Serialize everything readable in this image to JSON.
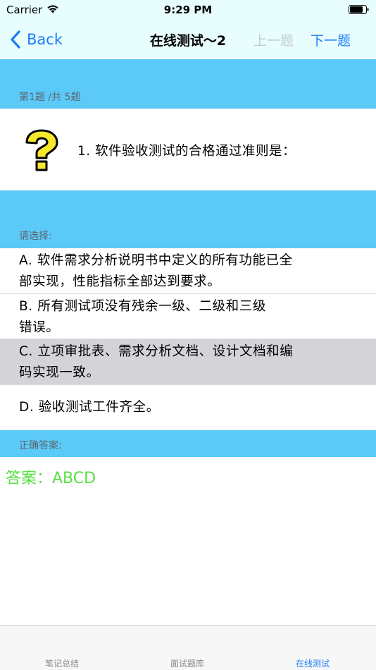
{
  "status_bar": {
    "carrier": "Carrier",
    "time": "9:29 PM"
  },
  "nav": {
    "back_label": "Back",
    "title": "在线测试～2",
    "prev_label": "上一题",
    "next_label": "下一题"
  },
  "question": {
    "progress": "第1题 /共 5题",
    "text": "1.  软件验收测试的合格通过准则是："
  },
  "options_section": {
    "label": "请选择:",
    "options": [
      {
        "line1": "A.   软件需求分析说明书中定义的所有功能已全",
        "line2": "部实现，性能指标全部达到要求。"
      },
      {
        "line1": "B.   所有测试项没有残余一级、二级和三级",
        "line2": "错误。"
      },
      {
        "line1": "C.   立项审批表、需求分析文档、设计文档和编",
        "line2": "码实现一致。"
      },
      {
        "line1": "D.   验收测试工件齐全。",
        "line2": ""
      }
    ],
    "selected_index": 2
  },
  "answer_section": {
    "label": "正确答案:",
    "answer": "答案：ABCD"
  },
  "tab_bar": {
    "tabs": [
      {
        "label": "笔记总结",
        "active": false
      },
      {
        "label": "面试题库",
        "active": false
      },
      {
        "label": "在线测试",
        "active": true
      }
    ]
  },
  "colors": {
    "accent": "#1a7cf7",
    "band": "#5ccaf9",
    "nav_bg": "#e8fefe",
    "selected_row": "#d3d3d8",
    "answer": "#57e042",
    "question_icon": "#f7e82b"
  },
  "icons": {
    "status": [
      "wifi-icon",
      "battery-icon"
    ],
    "nav": [
      "chevron-left-icon"
    ],
    "question": "question-mark-icon"
  }
}
